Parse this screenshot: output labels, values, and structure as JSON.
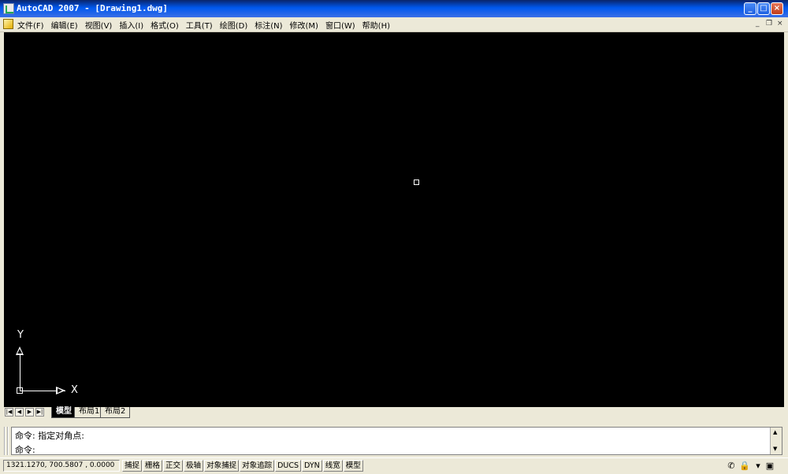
{
  "window": {
    "title": "AutoCAD 2007 - [Drawing1.dwg]"
  },
  "menu": {
    "items": [
      "文件(F)",
      "编辑(E)",
      "视图(V)",
      "插入(I)",
      "格式(O)",
      "工具(T)",
      "绘图(D)",
      "标注(N)",
      "修改(M)",
      "窗口(W)",
      "帮助(H)"
    ]
  },
  "ucs": {
    "x_label": "X",
    "y_label": "Y"
  },
  "layout_tabs": [
    "模型",
    "布局1",
    "布局2"
  ],
  "command": {
    "history": "命令: 指定对角点:",
    "prompt": "命令:"
  },
  "status": {
    "coords": "1321.1270, 700.5807 , 0.0000",
    "buttons": [
      "捕捉",
      "栅格",
      "正交",
      "极轴",
      "对象捕捉",
      "对象追踪",
      "DUCS",
      "DYN",
      "线宽",
      "模型"
    ]
  },
  "colors": {
    "canvas": "#000000",
    "chrome": "#ece9d8",
    "titlebar": "#0058ee"
  },
  "icons": [
    "autocad-app-icon",
    "minimize-icon",
    "maximize-icon",
    "close-icon",
    "document-icon",
    "pickbox-cursor",
    "ucs-icon",
    "communication-center-icon",
    "lock-icon",
    "tray-settings-icon",
    "clean-screen-icon"
  ]
}
